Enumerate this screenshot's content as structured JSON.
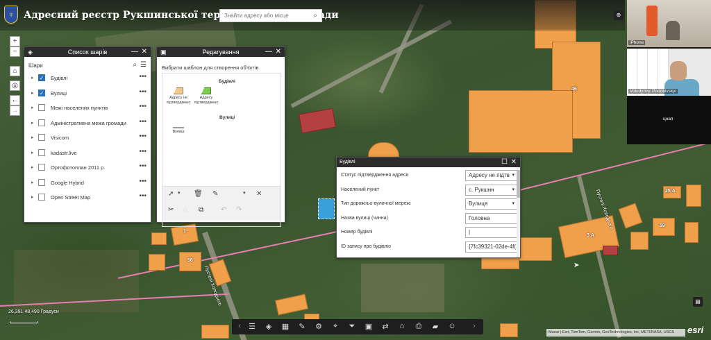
{
  "app": {
    "title": "Адресний реєстр Рукшинської територіальної громади",
    "search_placeholder": "Знайти адресу або місце"
  },
  "map": {
    "building_numbers": [
      "46",
      "1",
      "56",
      "25 А",
      "59",
      "3 А"
    ],
    "street_labels": [
      "Пустелі Холодного",
      "Пустелі Холодного"
    ],
    "coordinates": "26,391 48,490 Градуси",
    "scale_label": "",
    "attribution": "Maxar | Esri, TomTom, Garmin, GeoTechnologies, Inc, METI/NASA, USGS",
    "esri_logo": "esri"
  },
  "layer_list": {
    "title": "Список шарів",
    "section_label": "Шари",
    "layers": [
      {
        "name": "Будівлі",
        "checked": true
      },
      {
        "name": "Вулиці",
        "checked": true
      },
      {
        "name": "Межі населених пунктів",
        "checked": false
      },
      {
        "name": "Адміністративна межа громади",
        "checked": false
      },
      {
        "name": "Visicom",
        "checked": false
      },
      {
        "name": "kadastr.live",
        "checked": false
      },
      {
        "name": "Ортофотоплан 2011 р.",
        "checked": false
      },
      {
        "name": "Google Hybrid",
        "checked": false
      },
      {
        "name": "Open Street Map",
        "checked": false
      }
    ]
  },
  "edit_panel": {
    "title": "Редагування",
    "hint": "Вибрати шаблон для створення об'єктів",
    "groups": [
      {
        "title": "Будівлі",
        "templates": [
          "Адресу не підтверджено",
          "Адресу підтверджено"
        ]
      },
      {
        "title": "Вулиці",
        "templates": [
          "Вулиці"
        ]
      }
    ]
  },
  "attributes": {
    "title": "Будівлі",
    "rows": [
      {
        "label": "Статус підтвердження адреси",
        "value": "Адресу не підтв",
        "dropdown": true
      },
      {
        "label": "Населений пункт",
        "value": "с. Рукшин",
        "dropdown": true
      },
      {
        "label": "Тип дорожньо-вуличної мережі",
        "value": "Вулиця",
        "dropdown": true
      },
      {
        "label": "Назва вулиці (чинна)",
        "value": "Головна",
        "dropdown": false
      },
      {
        "label": "Номер будівлі",
        "value": "|",
        "dropdown": false
      },
      {
        "label": "ID запису про будівлю",
        "value": "{7fc39321-02de-4f(",
        "dropdown": false
      }
    ]
  },
  "video": {
    "labels": [
      "iPhone",
      "Volodymyr Podobivskyi",
      "цнап"
    ]
  },
  "colors": {
    "header_bg": "#141414",
    "building": "#f0a04b",
    "selected_building": "#3aa0d8",
    "boundary": "#e87eb0",
    "panel_head": "#2c2c2c",
    "checkbox_on": "#2a6fb8"
  },
  "icons": {
    "map_tools": [
      "zoom-in-icon",
      "zoom-out-icon",
      "home-icon",
      "locate-icon",
      "back-icon",
      "forward-icon"
    ],
    "bottom_toolbar": [
      "prev-arrow-icon",
      "legend-icon",
      "layers-icon",
      "basemap-gallery-icon",
      "draw-icon",
      "analysis-icon",
      "measure-icon",
      "filter-icon",
      "edit-icon",
      "swipe-icon",
      "home-icon",
      "print-icon",
      "bookmark-icon",
      "about-icon",
      "next-arrow-icon"
    ]
  }
}
